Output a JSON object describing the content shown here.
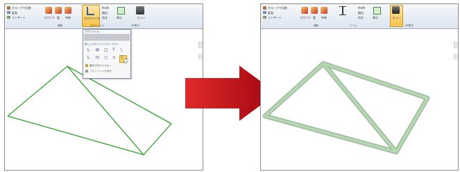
{
  "left_panel": {
    "ribbon": {
      "btn_group_split": "グループで分割",
      "btn_extend": "延長",
      "btn_insert": "インサート",
      "btn_round": "ラウンド",
      "btn_c": "面",
      "btn_d": "中央",
      "btn_profile": "プロファイル",
      "btn_profile_a": "Profil",
      "btn_profile_b": "抽出",
      "btn_orientation": "向き",
      "btn_display": "表示",
      "btn_view": "ビュー",
      "group_label_1": "面取",
      "group_label_2": "プロファイル",
      "group_label_3": "AR表示"
    },
    "dropdown": {
      "header": "プロファイル",
      "menu_title": "新しいプロファイルライブラリ",
      "row1": [
        "L",
        "⊞",
        "□",
        "T",
        "\\"
      ],
      "row2": [
        "L",
        "⊡",
        "○",
        "∩",
        "T"
      ],
      "item_other": "他のプロファイル...",
      "item_save": "プロファイルを保存"
    }
  },
  "right_panel": {
    "ribbon": {
      "btn_group_split": "グループで分割",
      "btn_extend": "延長",
      "btn_insert": "インサート",
      "btn_round": "ラウンド",
      "btn_c": "面",
      "btn_d": "中央",
      "btn_profile_a": "Profil",
      "btn_profile_b": "抽出",
      "btn_orientation": "向き",
      "btn_display": "表示",
      "btn_view": "ビュー",
      "group_label_1": "面取",
      "group_label_2": "ビーム",
      "group_label_3": "AR表示"
    }
  },
  "colors": {
    "wireframe": "#2fa12f",
    "beam_fill": "#9cc79a",
    "beam_edge": "#5e8d5c",
    "arrow": "#c8101a",
    "accent_yellow": "#f2b800"
  }
}
